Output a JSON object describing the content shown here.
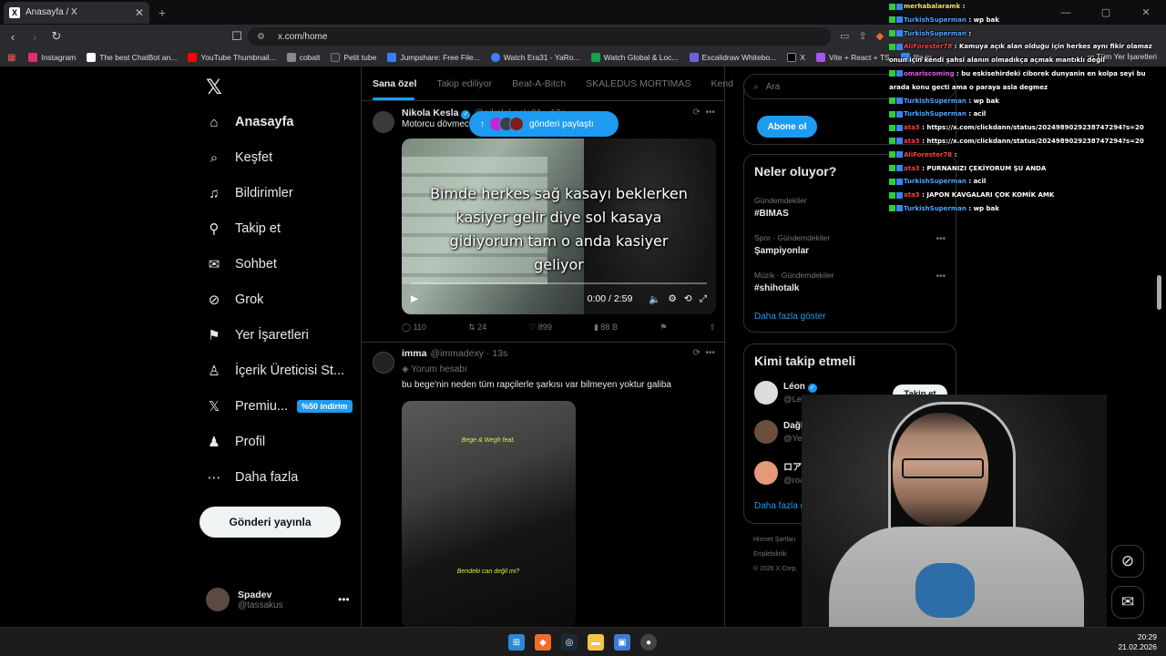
{
  "browser": {
    "tab_title": "Anasayfa / X",
    "url": "x.com/home",
    "bookmarks": [
      {
        "label": "Instagram",
        "color": "#e1306c"
      },
      {
        "label": "The best ChatBot an...",
        "color": "#ffffff"
      },
      {
        "label": "YouTube Thumbnail...",
        "color": "#ff0000"
      },
      {
        "label": "cobalt",
        "color": "#888888"
      },
      {
        "label": "Petit tube",
        "color": "#333333"
      },
      {
        "label": "Jumpshare: Free File...",
        "color": "#3d7bf5"
      },
      {
        "label": "Watch Era31 - YaRo...",
        "color": "#3b82f6"
      },
      {
        "label": "Watch Global & Loc...",
        "color": "#16a34a"
      },
      {
        "label": "Excalidraw Whitebo...",
        "color": "#6965db"
      },
      {
        "label": "X",
        "color": "#000000"
      },
      {
        "label": "Vite + React + TS",
        "color": "#a855f7"
      },
      {
        "label": "file.io",
        "color": "#3b82f6"
      }
    ],
    "all_bookmarks": "Tüm Yer İşaretleri"
  },
  "nav": {
    "items": [
      {
        "label": "Anasayfa",
        "icon": "home-icon"
      },
      {
        "label": "Keşfet",
        "icon": "search-icon"
      },
      {
        "label": "Bildirimler",
        "icon": "bell-icon"
      },
      {
        "label": "Takip et",
        "icon": "person-plus-icon"
      },
      {
        "label": "Sohbet",
        "icon": "mail-icon"
      },
      {
        "label": "Grok",
        "icon": "grok-icon"
      },
      {
        "label": "Yer İşaretleri",
        "icon": "bookmark-icon"
      },
      {
        "label": "İçerik Üreticisi St...",
        "icon": "creator-studio-icon"
      },
      {
        "label": "Premiu...",
        "icon": "x-logo-icon"
      },
      {
        "label": "Profil",
        "icon": "person-icon"
      },
      {
        "label": "Daha fazla",
        "icon": "more-circle-icon"
      }
    ],
    "premium_badge": "%50 indirim",
    "post_button": "Gönderi yayınla",
    "profile": {
      "name": "Spadev",
      "handle": "@tassakus"
    }
  },
  "timeline": {
    "tabs": [
      "Sana özel",
      "Takip ediliyor",
      "Beat-A-Bitch",
      "SKALEDUS MORTIMAS",
      "Kend"
    ],
    "new_posts_pill": "gönderi paylaştı",
    "posts": [
      {
        "name": "Nikola Kesla",
        "handle": "@nikolakesla01 · 13s",
        "text": "Motorcu dövmec",
        "video_caption": "Bimde herkes sağ kasayı beklerken kasiyer gelir diye sol kasaya gidiyorum tam o anda kasiyer geliyor",
        "video_time": "0:00 / 2:59",
        "replies": "110",
        "reposts": "24",
        "likes": "899",
        "views": "88 B"
      },
      {
        "name": "imma",
        "handle": "@immadexy · 13s",
        "context": "Yorum hesabı",
        "text": "bu bege'nin neden tüm rapçilerle şarkısı var bilmeyen yoktur galiba",
        "video_caption_top": "Bege & Wegh feat.",
        "video_caption_bottom": "Bendeki can değil mi?"
      }
    ]
  },
  "sidebar": {
    "search_placeholder": "Ara",
    "subscribe_button": "Abone ol",
    "trends_title": "Neler oluyor?",
    "trends": [
      {
        "category": "Gündemdekiler",
        "title": "#BIMAS"
      },
      {
        "category": "Spor · Gündemdekiler",
        "title": "Şampiyonlar"
      },
      {
        "category": "Müzik · Gündemdekiler",
        "title": "#shihotalk"
      }
    ],
    "show_more": "Daha fazla göster",
    "wtf_title": "Kimi takip etmeli",
    "follow_button": "Takip et",
    "suggestions": [
      {
        "name": "Léon",
        "handle": "@Leonizm351"
      },
      {
        "name": "Dağhan Yet",
        "handle": "@YetDaghan"
      },
      {
        "name": "ロアネア@最多情報...",
        "handle": "@roaneatan"
      }
    ],
    "footer": [
      "Hizmet Şartları",
      "Erişilebilirlik",
      "© 2026 X Corp."
    ]
  },
  "chat": [
    {
      "user": "merhabalaramk",
      "msg": "",
      "color": "#f5e663"
    },
    {
      "user": "TurkishSuperman",
      "msg": "wp bak",
      "color": "#4aa3ff"
    },
    {
      "user": "TurkishSuperman",
      "msg": "",
      "color": "#4aa3ff"
    },
    {
      "user": "AliForester78",
      "msg": "Kamuya açık alan olduğu için herkes aynı fikir olamaz onun için kendi şahsi alanın olmadıkça açmak mantıklı değil",
      "color": "#ff3b3b"
    },
    {
      "user": "omariscoming",
      "msg": "bu eskisehirdeki ciborek dunyanin en kolpa seyi bu arada konu gecti ama o paraya asla degmez",
      "color": "#e058e0"
    },
    {
      "user": "TurkishSuperman",
      "msg": "wp bak",
      "color": "#4aa3ff"
    },
    {
      "user": "TurkishSuperman",
      "msg": "acil",
      "color": "#4aa3ff"
    },
    {
      "user": "ata3",
      "msg": "https://x.com/clickdann/status/2024989029238747294?s=20",
      "color": "#ff3b3b"
    },
    {
      "user": "ata3",
      "msg": "https://x.com/clickdann/status/2024989029238747294?s=20",
      "color": "#ff3b3b"
    },
    {
      "user": "AliForester78",
      "msg": "",
      "color": "#ff3b3b"
    },
    {
      "user": "ata3",
      "msg": "PURNANIZI ÇEKİYORUM ŞU ANDA",
      "color": "#ff3b3b"
    },
    {
      "user": "TurkishSuperman",
      "msg": "acil",
      "color": "#4aa3ff"
    },
    {
      "user": "ata3",
      "msg": "JAPON KAVGALARI ÇOK KOMİK AMK",
      "color": "#ff3b3b"
    },
    {
      "user": "TurkishSuperman",
      "msg": "wp bak",
      "color": "#4aa3ff"
    }
  ],
  "taskbar": {
    "time": "20:29",
    "date": "21.02.2026"
  }
}
